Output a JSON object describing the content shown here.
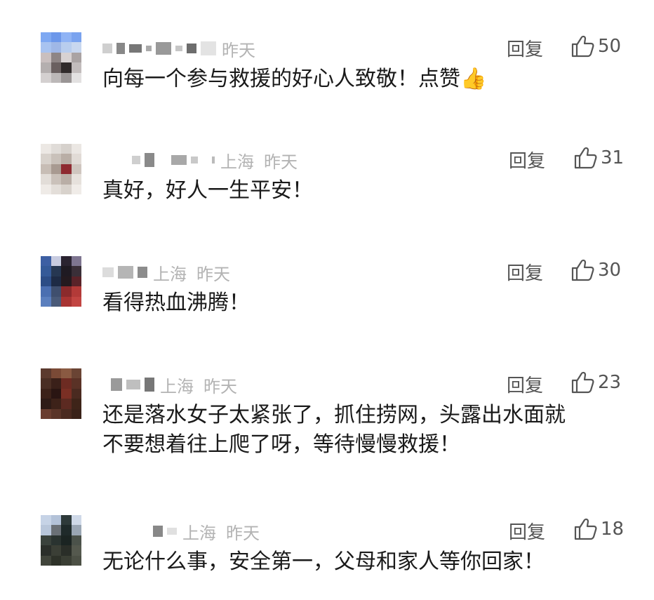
{
  "comments": [
    {
      "location": "",
      "time": "昨天",
      "reply_label": "回复",
      "likes": "50",
      "text": "向每一个参与救援的好心人致敬！点赞",
      "emoji": "👍",
      "avatar_colors": [
        "#7ea8f2",
        "#6c97ea",
        "#8fb3f5",
        "#7aa3ef",
        "#a8c3f0",
        "#9fb7e6",
        "#b8cdee",
        "#c8d7ef",
        "#c9bfbf",
        "#8e8585",
        "#d8d2d2",
        "#aaa3a3",
        "#b4afaf",
        "#6a6060",
        "#302a2a",
        "#c2bcbc",
        "#d4d0d0",
        "#bcb8b8",
        "#9a9595",
        "#e3e1e1"
      ]
    },
    {
      "location": "上海",
      "time": "昨天",
      "reply_label": "回复",
      "likes": "31",
      "text": "真好，好人一生平安！",
      "emoji": "",
      "avatar_colors": [
        "#ece8e4",
        "#e0dcd8",
        "#d6d1cc",
        "#ebe7e3",
        "#d8d2cc",
        "#c9c1ba",
        "#b9aea6",
        "#e1dbd6",
        "#c7bdb5",
        "#a89a91",
        "#8e2a30",
        "#cfc6bf",
        "#e2ddd8",
        "#cac1ba",
        "#b9aea6",
        "#e6e1dc",
        "#efebe7",
        "#e3ded9",
        "#d8d2cc",
        "#f0ece8"
      ]
    },
    {
      "location": "上海",
      "time": "昨天",
      "reply_label": "回复",
      "likes": "30",
      "text": "看得热血沸腾！",
      "emoji": "",
      "avatar_colors": [
        "#3d5fa3",
        "#c7cbe0",
        "#2a2330",
        "#7e7590",
        "#355a98",
        "#263752",
        "#1f1a22",
        "#3a2f38",
        "#2c4d86",
        "#1e2b45",
        "#241a1f",
        "#5a2329",
        "#4b6fb1",
        "#3f4f6e",
        "#8b2a2c",
        "#b33a38",
        "#5b7fbe",
        "#4a5a78",
        "#a83433",
        "#c24542"
      ]
    },
    {
      "location": "上海",
      "time": "昨天",
      "reply_label": "回复",
      "likes": "23",
      "text": "还是落水女子太紧张了，抓住捞网，头露出水面就\n不要想着往上爬了呀，等待慢慢救援！",
      "emoji": "",
      "avatar_colors": [
        "#5b3a2e",
        "#7a4a36",
        "#8a5a42",
        "#6a4434",
        "#4a2e24",
        "#3a2019",
        "#6d2b22",
        "#5a3226",
        "#3c2219",
        "#2a1512",
        "#7a2f24",
        "#4a2a20",
        "#2e1b16",
        "#3d2219",
        "#5c2a21",
        "#3e2419",
        "#6a3e30",
        "#5a3428",
        "#4a2a20",
        "#3a2219"
      ]
    },
    {
      "location": "上海",
      "time": "昨天",
      "reply_label": "回复",
      "likes": "18",
      "text": "无论什么事，安全第一，父母和家人等你回家！",
      "emoji": "",
      "avatar_colors": [
        "#c6d3e6",
        "#b3c2d8",
        "#2e3a3a",
        "#cfd9e8",
        "#b8c6da",
        "#6a7076",
        "#1f2a2a",
        "#9aa6b4",
        "#3a423c",
        "#2a3330",
        "#1b2422",
        "#4b524a",
        "#2b2f2a",
        "#3b3f36",
        "#2a2e28",
        "#55594e",
        "#41453b",
        "#2e3229",
        "#3a3e34",
        "#4c5045"
      ]
    }
  ],
  "colors": {
    "text": "#1a1a1a",
    "meta": "#b3b3b3",
    "action": "#555555"
  }
}
